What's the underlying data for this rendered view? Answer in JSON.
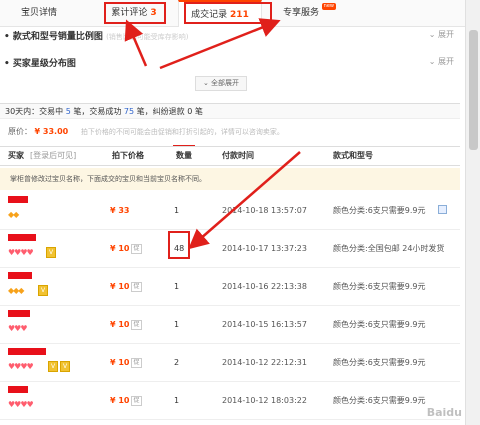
{
  "tabs": [
    {
      "label": "宝贝详情",
      "num": ""
    },
    {
      "label": "累计评论",
      "num": "3"
    },
    {
      "label": "成交记录",
      "num": "211"
    },
    {
      "label": "专享服务",
      "num": "",
      "badge": "new"
    }
  ],
  "sections": [
    {
      "title": "款式和型号销量比例图",
      "sub": "(销售比例可能受库存影响)",
      "action": "展开"
    },
    {
      "title": "买家星级分布图",
      "action": "展开"
    }
  ],
  "all_expand": "全部展开",
  "stats": {
    "prefix": "30天内：交易中",
    "trading": "5",
    "mid1": "笔，交易成功",
    "success": "75",
    "mid2": "笔，纠纷退款",
    "refund": "0",
    "suffix": "笔"
  },
  "price_line": {
    "label": "原价：",
    "price": "¥ 33.00",
    "hint": "拍下价格的不同可能会由促销和打折引起的，详情可以咨询卖家。"
  },
  "table": {
    "headers": {
      "buyer": "买家",
      "buyer_link": "[登录后可见]",
      "price": "拍下价格",
      "qty": "数量",
      "time": "付款时间",
      "style": "款式和型号"
    },
    "notice": "掌柜曾修改过宝贝名称，下面成交的宝贝和当前宝贝名称不同。",
    "rows": [
      {
        "price": "¥ 33",
        "promo": "",
        "qty": "1",
        "time": "2014-10-18 13:57:07",
        "style": "颜色分类:6支只需要9.9元",
        "checkbox": true,
        "level": "diamond"
      },
      {
        "price": "¥ 10",
        "promo": "促",
        "qty": "48",
        "time": "2014-10-17 13:37:23",
        "style": "颜色分类:全国包邮 24小时发货",
        "checkbox": false,
        "level": "heart"
      },
      {
        "price": "¥ 10",
        "promo": "促",
        "qty": "1",
        "time": "2014-10-16 22:13:38",
        "style": "颜色分类:6支只需要9.9元",
        "checkbox": false,
        "level": "diamond"
      },
      {
        "price": "¥ 10",
        "promo": "促",
        "qty": "1",
        "time": "2014-10-15 16:13:57",
        "style": "颜色分类:6支只需要9.9元",
        "checkbox": false,
        "level": "heart"
      },
      {
        "price": "¥ 10",
        "promo": "促",
        "qty": "2",
        "time": "2014-10-12 22:12:31",
        "style": "颜色分类:6支只需要9.9元",
        "checkbox": false,
        "level": "heart"
      },
      {
        "price": "¥ 10",
        "promo": "促",
        "qty": "1",
        "time": "2014-10-12 18:03:22",
        "style": "颜色分类:6支只需要9.9元",
        "checkbox": false,
        "level": "heart"
      }
    ]
  },
  "watermark": "Baidu",
  "colors": {
    "accent": "#ff4400",
    "annotation": "#e0201b",
    "notice_bg": "#fdf6e3"
  }
}
